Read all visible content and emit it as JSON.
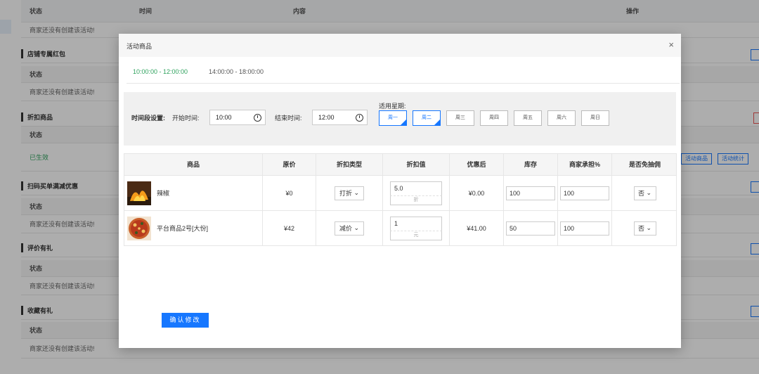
{
  "background": {
    "header": {
      "status": "状态",
      "time": "时间",
      "content": "内容",
      "action": "操作"
    },
    "not_created": "商家还没有创建该活动!",
    "status_label": "状态",
    "effective": "已生效",
    "sections": {
      "red_packet": "店铺专属红包",
      "discount_goods": "折扣商品",
      "scan_order": "扫码买单满减优惠",
      "review_gift": "评价有礼",
      "favorite_gift": "收藏有礼"
    },
    "buttons": {
      "activity_goods": "活动商品",
      "activity_stats": "活动统计"
    }
  },
  "modal": {
    "title": "活动商品",
    "close_icon": "×",
    "tabs": [
      {
        "label": "10:00:00 - 12:00:00",
        "active": true
      },
      {
        "label": "14:00:00 - 18:00:00",
        "active": false
      }
    ],
    "settings": {
      "time_setting_label": "时间段设置:",
      "start_label": "开始时间:",
      "start_value": "10:00",
      "end_label": "结束时间:",
      "end_value": "12:00",
      "weekday_label": "适用星期:",
      "weekdays": [
        {
          "label": "周一",
          "selected": true
        },
        {
          "label": "周二",
          "selected": true
        },
        {
          "label": "周三",
          "selected": false
        },
        {
          "label": "周四",
          "selected": false
        },
        {
          "label": "周五",
          "selected": false
        },
        {
          "label": "周六",
          "selected": false
        },
        {
          "label": "周日",
          "selected": false
        }
      ]
    },
    "table": {
      "columns": [
        "商品",
        "原价",
        "折扣类型",
        "折扣值",
        "优惠后",
        "库存",
        "商家承担%",
        "是否免抽佣"
      ],
      "rows": [
        {
          "name": "辣椒",
          "price": "¥0",
          "discount_type": "打折",
          "discount_value": "5.0",
          "unit": "折",
          "after": "¥0.00",
          "stock": "100",
          "merchant_share": "100",
          "commission_free": "否"
        },
        {
          "name": "平台商品2号[大份]",
          "price": "¥42",
          "discount_type": "减价",
          "discount_value": "1",
          "unit": "元",
          "after": "¥41.00",
          "stock": "50",
          "merchant_share": "100",
          "commission_free": "否"
        }
      ]
    },
    "confirm_label": "确认修改"
  },
  "colors": {
    "accent": "#1677ff",
    "active_tab": "#2fa25e"
  }
}
